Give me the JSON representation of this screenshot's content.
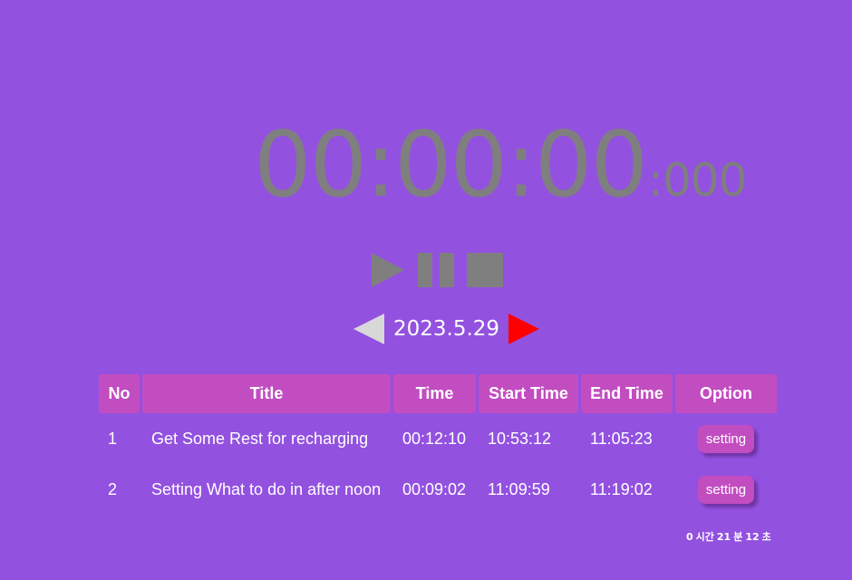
{
  "timer": {
    "main": "00:00:00",
    "ms": ":000"
  },
  "controls": {
    "play": "play-icon",
    "pause": "pause-icon",
    "stop": "stop-icon"
  },
  "date_nav": {
    "date": "2023.5.29",
    "prev_icon": "left-triangle-icon",
    "next_icon": "right-triangle-icon"
  },
  "colors": {
    "background": "#9351e0",
    "accent": "#c24dc1",
    "timer_text": "#7f7f7f",
    "next_arrow": "#ff0000",
    "prev_arrow": "#d8d8d8"
  },
  "table": {
    "headers": [
      "No",
      "Title",
      "Time",
      "Start Time",
      "End Time",
      "Option"
    ],
    "rows": [
      {
        "no": "1",
        "title": "Get Some Rest for recharging",
        "time": "00:12:10",
        "start": "10:53:12",
        "end": "11:05:23",
        "option": "setting"
      },
      {
        "no": "2",
        "title": "Setting What to do in after noon",
        "time": "00:09:02",
        "start": "11:09:59",
        "end": "11:19:02",
        "option": "setting"
      }
    ]
  },
  "total": {
    "hours": "0",
    "hours_unit": "시간",
    "minutes": "21",
    "minutes_unit": "분",
    "seconds": "12",
    "seconds_unit": "초"
  }
}
